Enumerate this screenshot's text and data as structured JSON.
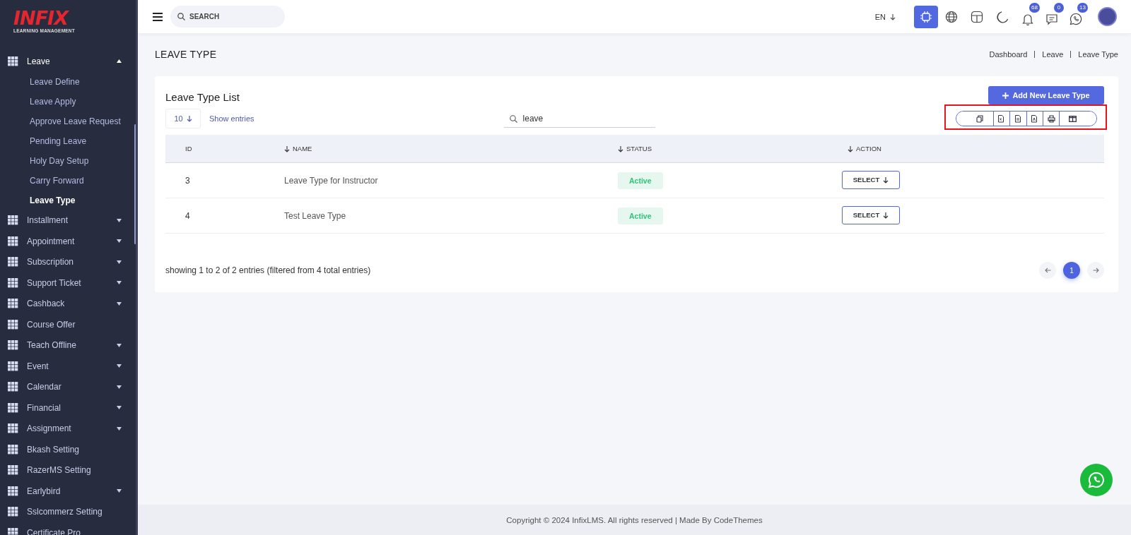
{
  "brand": {
    "name": "INFIX",
    "tagline": "LEARNING MANAGEMENT"
  },
  "sidebar": {
    "items": [
      {
        "label": "Leave",
        "kind": "group",
        "expanded": true,
        "children": [
          {
            "label": "Leave Define",
            "selected": false
          },
          {
            "label": "Leave Apply",
            "selected": false
          },
          {
            "label": "Approve Leave Request",
            "selected": false
          },
          {
            "label": "Pending Leave",
            "selected": false
          },
          {
            "label": "Holy Day Setup",
            "selected": false
          },
          {
            "label": "Carry Forward",
            "selected": false
          },
          {
            "label": "Leave Type",
            "selected": true
          }
        ]
      },
      {
        "label": "Installment",
        "kind": "group",
        "expanded": false
      },
      {
        "label": "Appointment",
        "kind": "group",
        "expanded": false
      },
      {
        "label": "Subscription",
        "kind": "group",
        "expanded": false
      },
      {
        "label": "Support Ticket",
        "kind": "group",
        "expanded": false
      },
      {
        "label": "Cashback",
        "kind": "group",
        "expanded": false
      },
      {
        "label": "Course Offer",
        "kind": "link"
      },
      {
        "label": "Teach Offline",
        "kind": "group",
        "expanded": false
      },
      {
        "label": "Event",
        "kind": "group",
        "expanded": false
      },
      {
        "label": "Calendar",
        "kind": "group",
        "expanded": false
      },
      {
        "label": "Financial",
        "kind": "group",
        "expanded": false
      },
      {
        "label": "Assignment",
        "kind": "group",
        "expanded": false
      },
      {
        "label": "Bkash Setting",
        "kind": "link"
      },
      {
        "label": "RazerMS Setting",
        "kind": "link"
      },
      {
        "label": "Earlybird",
        "kind": "group",
        "expanded": false
      },
      {
        "label": "Sslcommerz Setting",
        "kind": "link"
      },
      {
        "label": "Certificate Pro",
        "kind": "link"
      }
    ]
  },
  "topbar": {
    "search": {
      "placeholder": "SEARCH"
    },
    "language": "EN",
    "tools": [
      {
        "kind": "ai",
        "active": true
      },
      {
        "kind": "globe",
        "active": false
      },
      {
        "kind": "layout",
        "active": false
      },
      {
        "kind": "moon",
        "active": false
      }
    ],
    "notifications": [
      {
        "kind": "bell",
        "count": "68"
      },
      {
        "kind": "chat",
        "count": "0"
      },
      {
        "kind": "phone",
        "count": "13"
      }
    ]
  },
  "page": {
    "title": "LEAVE TYPE",
    "breadcrumb": [
      "Dashboard",
      "Leave",
      "Leave Type"
    ]
  },
  "card": {
    "title": "Leave Type List",
    "add_button": "Add New Leave Type",
    "page_size": "10",
    "show_entries": "Show entries",
    "search": {
      "value": "leave"
    },
    "export_tools": {
      "highlighted": true,
      "buttons": [
        {
          "kind": "copy"
        },
        {
          "kind": "excel"
        },
        {
          "kind": "csv"
        },
        {
          "kind": "pdf"
        },
        {
          "kind": "print"
        },
        {
          "kind": "columns"
        }
      ]
    },
    "table": {
      "columns": [
        {
          "label": "ID",
          "sortable": false
        },
        {
          "label": "NAME",
          "sortable": true
        },
        {
          "label": "STATUS",
          "sortable": true
        },
        {
          "label": "ACTION",
          "sortable": true
        }
      ],
      "rows": [
        {
          "id": "3",
          "name": "Leave Type for Instructor",
          "status": "Active",
          "active": true,
          "action": "SELECT"
        },
        {
          "id": "4",
          "name": "Test Leave Type",
          "status": "Active",
          "active": true,
          "action": "SELECT"
        }
      ]
    },
    "info": "showing 1 to 2 of 2 entries (filtered from 4 total entries)",
    "pagination": [
      {
        "label": "1",
        "selected": true
      }
    ]
  },
  "footer": "Copyright © 2024 InfixLMS. All rights reserved | Made By CodeThemes"
}
